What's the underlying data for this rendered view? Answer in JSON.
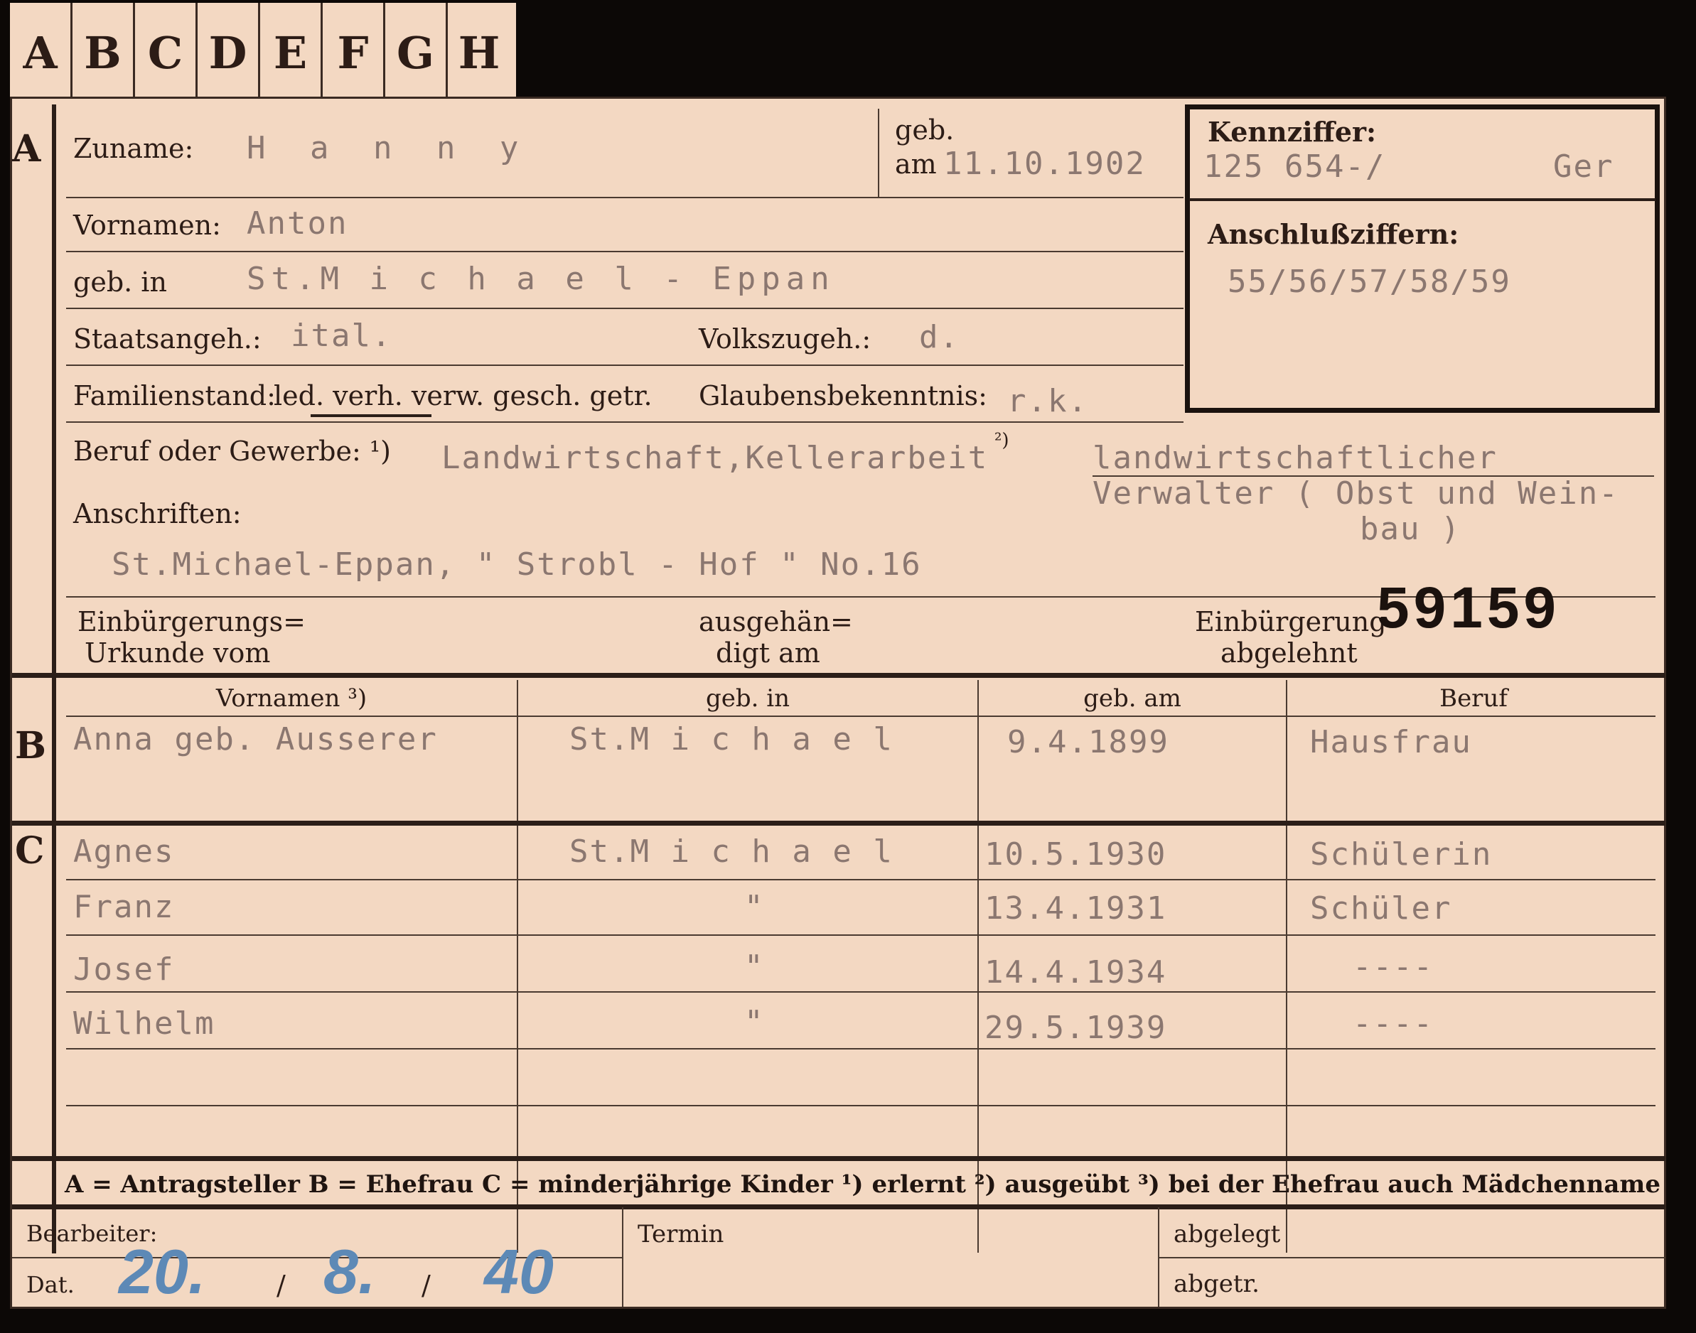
{
  "tabs": [
    "A",
    "B",
    "C",
    "D",
    "E",
    "F",
    "G",
    "H"
  ],
  "section_a": {
    "marker": "A",
    "zuname_label": "Zuname:",
    "zuname_value": "H a n n y",
    "geb_label": "geb.",
    "am_label": "am",
    "geb_am_value": "11.10.1902",
    "kennziffer_label": "Kennziffer:",
    "kennziffer_value": "125 654-/",
    "kennziffer_suffix": "Ger",
    "anschluss_label": "Anschlußziffern:",
    "anschluss_value": "55/56/57/58/59",
    "vornamen_label": "Vornamen:",
    "vornamen_value": "Anton",
    "geb_in_label": "geb. in",
    "geb_in_value": "St.M i c h a e l - Eppan",
    "staatsangeh_label": "Staatsangeh.:",
    "staatsangeh_value": "ital.",
    "volkszugeh_label": "Volkszugeh.:",
    "volkszugeh_value": "d.",
    "familienstand_label": "Familienstand:",
    "familienstand_options": "led. verh. verw. gesch. getr.",
    "glauben_label": "Glaubensbekenntnis:",
    "glauben_value": "r.k.",
    "beruf_label": "Beruf oder Gewerbe: ¹)",
    "beruf_value": "Landwirtschaft,Kellerarbeit",
    "beruf_marker": "²)",
    "beruf_ausgeuebt_1": "landwirtschaftlicher",
    "beruf_ausgeuebt_2": "Verwalter ( Obst und Wein-",
    "beruf_ausgeuebt_3": "bau )",
    "anschriften_label": "Anschriften:",
    "anschriften_value": "St.Michael-Eppan, \" Strobl - Hof \" No.16",
    "urkunde_label_1": "Einbürgerungs=",
    "urkunde_label_2": "Urkunde vom",
    "ausgehaendigt_label_1": "ausgehän=",
    "ausgehaendigt_label_2": "digt am",
    "abgelehnt_label_1": "Einbürgerung",
    "abgelehnt_label_2": "abgelehnt",
    "stamp_number": "59159"
  },
  "section_b": {
    "marker": "B",
    "col_vornamen": "Vornamen ³)",
    "col_geb_in": "geb. in",
    "col_geb_am": "geb. am",
    "col_beruf": "Beruf",
    "vornamen": "Anna geb. Ausserer",
    "geb_in": "St.M i c h a e l",
    "geb_am": "9.4.1899",
    "beruf": "Hausfrau"
  },
  "section_c": {
    "marker": "C",
    "rows": [
      {
        "name": "Agnes",
        "place": "St.M i c h a e l",
        "date": "10.5.1930",
        "job": "Schülerin"
      },
      {
        "name": "Franz",
        "place": "\"",
        "date": "13.4.1931",
        "job": "Schüler"
      },
      {
        "name": "Josef",
        "place": "\"",
        "date": "14.4.1934",
        "job": "----"
      },
      {
        "name": "Wilhelm",
        "place": "\"",
        "date": "29.5.1939",
        "job": "----"
      },
      {
        "name": "",
        "place": "",
        "date": "",
        "job": ""
      },
      {
        "name": "",
        "place": "",
        "date": "",
        "job": ""
      }
    ]
  },
  "legend": "A = Antragsteller   B = Ehefrau   C = minderjährige Kinder   ¹) erlernt   ²) ausgeübt   ³) bei der Ehefrau auch Mädchenname",
  "footer": {
    "bearbeiter_label": "Bearbeiter:",
    "dat_label": "Dat.",
    "dat_day": "20.",
    "dat_month": "8.",
    "dat_year": "40",
    "dat_sep": "/",
    "termin_label": "Termin",
    "abgelegt_label": "abgelegt",
    "abgetr_label": "abgetr."
  }
}
